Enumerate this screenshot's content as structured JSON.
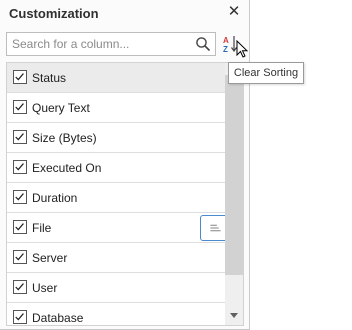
{
  "panel": {
    "title": "Customization",
    "close_symbol": "✕",
    "search": {
      "placeholder": "Search for a column..."
    },
    "sort": {
      "top_letter": "A",
      "bottom_letter": "Z",
      "tooltip": "Clear Sorting"
    }
  },
  "columns": [
    {
      "label": "Status",
      "checked": true
    },
    {
      "label": "Query Text",
      "checked": true
    },
    {
      "label": "Size (Bytes)",
      "checked": true
    },
    {
      "label": "Executed On",
      "checked": true
    },
    {
      "label": "Duration",
      "checked": true
    },
    {
      "label": "File",
      "checked": true
    },
    {
      "label": "Server",
      "checked": true
    },
    {
      "label": "User",
      "checked": true
    },
    {
      "label": "Database",
      "checked": true
    }
  ],
  "colors": {
    "accent_blue": "#4a8bd0",
    "sort_a_red": "#d43b3b",
    "sort_z_blue": "#2b6cb8"
  }
}
